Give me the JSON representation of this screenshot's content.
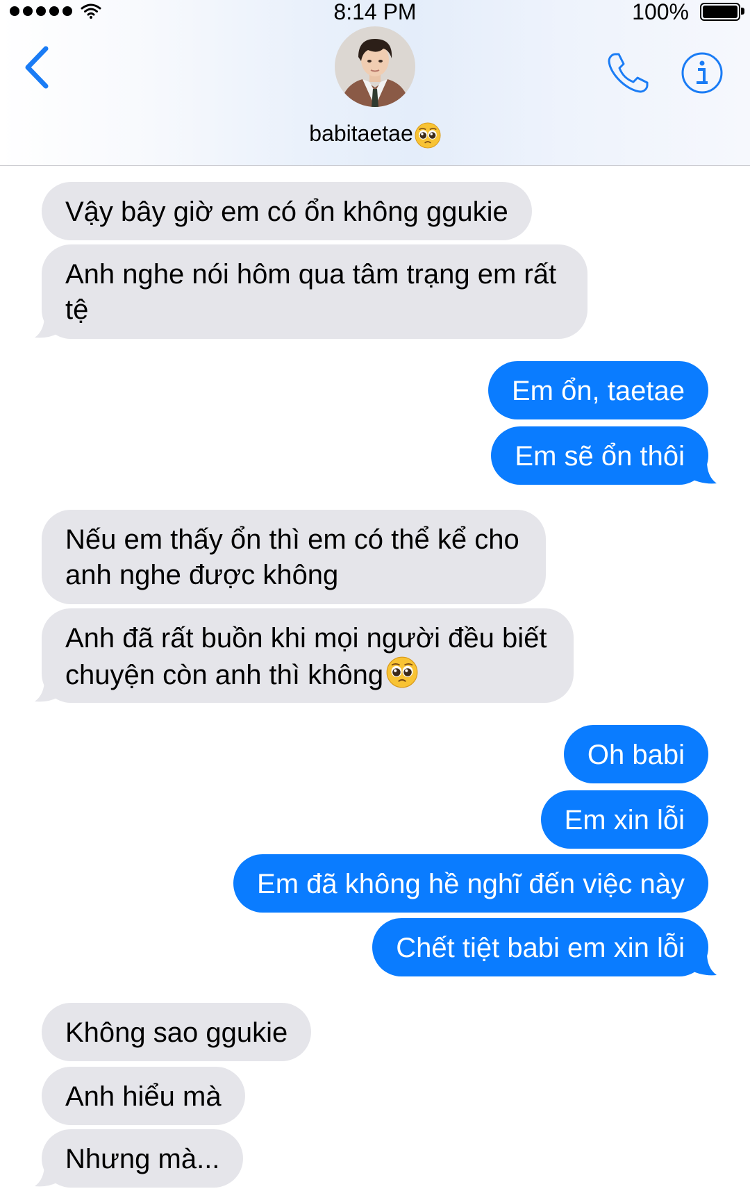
{
  "status_bar": {
    "time": "8:14 PM",
    "battery": "100%"
  },
  "header": {
    "contact_name": "babitaetae",
    "name_emoji": "pleading-face-emoji"
  },
  "colors": {
    "sent_bubble": "#0a7cff",
    "received_bubble": "#e5e5ea",
    "accent": "#1a7cf5"
  },
  "messages": [
    {
      "side": "received",
      "text": "Vậy bây giờ em có ổn không ggukie"
    },
    {
      "side": "received",
      "text": "Anh nghe nói hôm qua tâm trạng em rất tệ"
    },
    {
      "side": "sent",
      "text": "Em ổn, taetae"
    },
    {
      "side": "sent",
      "text": "Em sẽ ổn thôi"
    },
    {
      "side": "received",
      "text": "Nếu em thấy ổn thì em có thể kể cho anh nghe được không"
    },
    {
      "side": "received",
      "text": "Anh đã rất buồn khi mọi người đều biết chuyện còn anh thì không"
    },
    {
      "side": "sent",
      "text": "Oh babi"
    },
    {
      "side": "sent",
      "text": "Em xin lỗi"
    },
    {
      "side": "sent",
      "text": "Em đã không hề nghĩ đến việc này"
    },
    {
      "side": "sent",
      "text": "Chết tiệt babi em xin lỗi"
    },
    {
      "side": "received",
      "text": "Không sao ggukie"
    },
    {
      "side": "received",
      "text": "Anh hiểu mà"
    },
    {
      "side": "received",
      "text": "Nhưng mà..."
    }
  ]
}
